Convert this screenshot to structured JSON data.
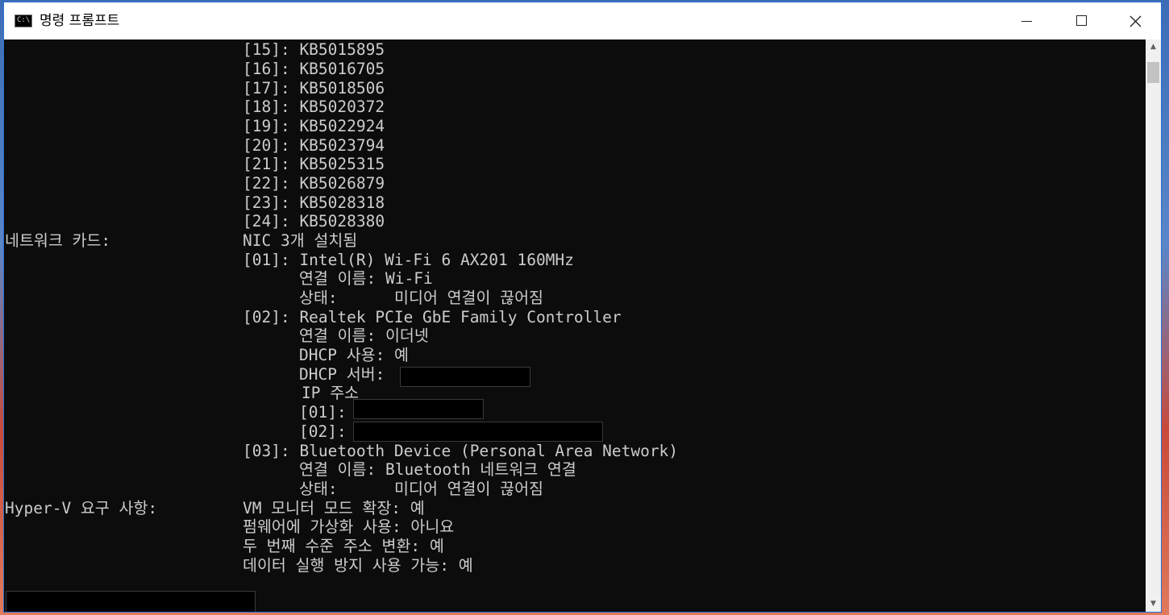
{
  "window": {
    "title": "명령 프롬프트",
    "icon": "cmd-icon",
    "icon_text": "C:\\"
  },
  "controls": {
    "minimize": "minimize-icon",
    "maximize": "maximize-icon",
    "close": "close-icon"
  },
  "console": {
    "hotfix_lines": [
      "[15]: KB5015895",
      "[16]: KB5016705",
      "[17]: KB5018506",
      "[18]: KB5020372",
      "[19]: KB5022924",
      "[20]: KB5023794",
      "[21]: KB5025315",
      "[22]: KB5026879",
      "[23]: KB5028318",
      "[24]: KB5028380"
    ],
    "network_label": "네트워크 카드:",
    "network_value": "NIC 3개 설치됨",
    "nic1": {
      "header": "[01]: Intel(R) Wi-Fi 6 AX201 160MHz",
      "conn": "연결 이름: Wi-Fi",
      "status": "상태:      미디어 연결이 끊어짐"
    },
    "nic2": {
      "header": "[02]: Realtek PCIe GbE Family Controller",
      "conn": "연결 이름: 이더넷",
      "dhcp": "DHCP 사용: 예",
      "dhcp_server": "DHCP 서버:",
      "ip": "IP 주소",
      "ip1": "[01]:",
      "ip2": "[02]:"
    },
    "nic3": {
      "header": "[03]: Bluetooth Device (Personal Area Network)",
      "conn": "연결 이름: Bluetooth 네트워크 연결",
      "status": "상태:      미디어 연결이 끊어짐"
    },
    "hyperv_label": "Hyper-V 요구 사항:",
    "hyperv_lines": [
      "VM 모니터 모드 확장: 예",
      "펌웨어에 가상화 사용: 아니요",
      "두 번째 수준 주소 변환: 예",
      "데이터 실행 방지 사용 가능: 예"
    ]
  },
  "colors": {
    "console_bg": "#0c0c0c",
    "console_text": "#cccccc",
    "titlebar_bg": "#ffffff",
    "border": "#2a6fd1"
  }
}
